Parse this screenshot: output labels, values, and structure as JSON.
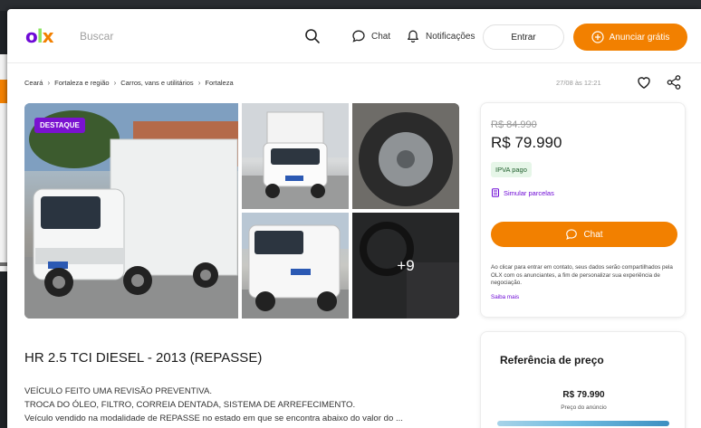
{
  "header": {
    "logo": {
      "o": "o",
      "l": "l",
      "x": "x"
    },
    "search_placeholder": "Buscar",
    "chat_label": "Chat",
    "notifications_label": "Notificações",
    "login_label": "Entrar",
    "post_ad_label": "Anunciar grátis"
  },
  "breadcrumb": [
    "Ceará",
    "Fortaleza e região",
    "Carros, vans e utilitários",
    "Fortaleza"
  ],
  "posted_at": "27/08 às 12:21",
  "gallery": {
    "badge": "DESTAQUE",
    "more_photos": "+9"
  },
  "price_card": {
    "old_price": "R$ 84.990",
    "price": "R$ 79.990",
    "ipva_tag": "IPVA pago",
    "simulate_label": "Simular parcelas",
    "chat_button": "Chat",
    "disclaimer": "Ao clicar para entrar em contato, seus dados serão compartilhados pela OLX com os anunciantes, a fim de personalizar sua experiência de negociação.",
    "learn_more": "Saiba mais"
  },
  "ad": {
    "title": "HR 2.5 TCI DIESEL - 2013 (REPASSE)",
    "description": [
      "VEÍCULO FEITO UMA REVISÃO PREVENTIVA.",
      "TROCA DO ÓLEO, FILTRO, CORREIA DENTADA, SISTEMA DE ARREFECIMENTO.",
      "Veículo vendido na modalidade de REPASSE no estado em que se encontra abaixo do valor do ..."
    ]
  },
  "price_reference": {
    "title": "Referência de preço",
    "price": "R$ 79.990",
    "subtitle": "Preço do anúncio"
  },
  "colors": {
    "brand_orange": "#f28000",
    "brand_purple": "#6e0ad6",
    "brand_green": "#8ce563"
  }
}
